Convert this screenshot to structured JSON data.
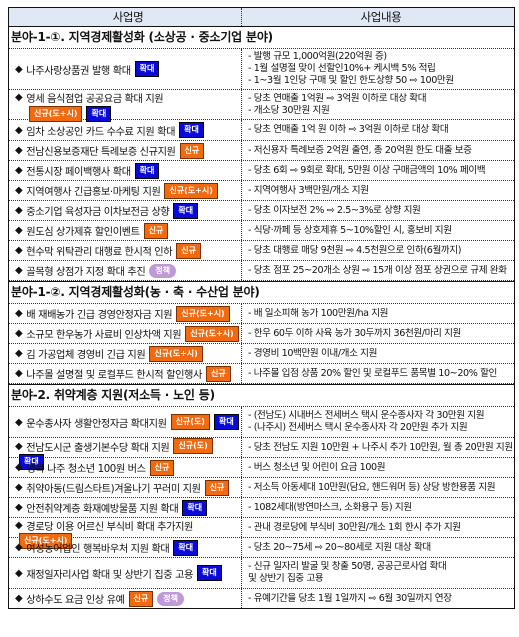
{
  "header": {
    "col1": "사업명",
    "col2": "사업내용"
  },
  "sections": [
    {
      "title": "분야-1-①. 지역경제활성화 (소상공 · 중소기업 분야)",
      "rows": [
        {
          "name": "나주사랑상품권 발행 확대",
          "badges": [
            {
              "label": "확대",
              "type": "expand"
            }
          ],
          "details": [
            "- 발행 규모 1,000억원(220억원 증)",
            "- 1월 설명절 맞이 선할인10%+ 케시백 5% 적립",
            "- 1~3월 1인당 구매 및 할인 한도상향 50 ⇨ 100만원"
          ]
        },
        {
          "name": "영세 음식점업 공공요금 확대 지원",
          "badges": [
            {
              "label": "신규(도+시)",
              "type": "new"
            },
            {
              "label": "확대",
              "type": "expand"
            }
          ],
          "wrap": true,
          "details": [
            "- 당초 연매출 1억원 ⇨ 3억원 이하로 대상 확대",
            "- 개소당 30만원 지원"
          ]
        },
        {
          "name": "임차 소상공인 카드 수수료 지원 확대",
          "badges": [
            {
              "label": "확대",
              "type": "expand"
            }
          ],
          "details": [
            "- 당초 연매출 1억 원 이하 ⇨ 3억원 이하로 대상 확대"
          ]
        },
        {
          "name": "전남신용보증재단 특례보증 신규지원",
          "badges": [
            {
              "label": "신규",
              "type": "new"
            }
          ],
          "details": [
            "- 저신용자 특례보증 2억원 출연, 총 20억원 한도 대출 보증"
          ]
        },
        {
          "name": "전통시장 페이백행사 확대",
          "badges": [
            {
              "label": "확대",
              "type": "expand"
            }
          ],
          "details": [
            "- 당초 6회 ⇨ 9회로 확대, 5만원 이상 구매금액의 10% 페이백"
          ]
        },
        {
          "name": "지역여행사 긴급홍보·마케팅 지원",
          "badges": [
            {
              "label": "신규(도+시)",
              "type": "new"
            }
          ],
          "details": [
            "- 지역여행사 3백만원/개소 지원"
          ]
        },
        {
          "name": "중소기업 육성자금 이차보전금 상향",
          "badges": [
            {
              "label": "확대",
              "type": "expand"
            }
          ],
          "details": [
            "- 당초 이자보전 2% ⇨ 2.5~3%로 상향 지원"
          ]
        },
        {
          "name": "원도심 상가제휴 할인이벤트",
          "badges": [
            {
              "label": "신규",
              "type": "new"
            }
          ],
          "details": [
            "- 식당·까페 등 상호제휴 5~10%할인 시, 홍보비 지원"
          ]
        },
        {
          "name": "현수막 위탁관리 대행료 한시적 인하",
          "badges": [
            {
              "label": "신규",
              "type": "new"
            }
          ],
          "details": [
            "- 당초 대행료 매당 9천원 ⇨ 4.5천원으로 인하(6월까지)"
          ]
        },
        {
          "name": "골목형 상점가 지정 확대 추진",
          "badges": [
            {
              "label": "정책",
              "type": "policy"
            }
          ],
          "details": [
            "- 당초 점포 25~20개소 상원 ⇨ 15개 이상 점포 상권으로 규제 완화"
          ]
        }
      ]
    },
    {
      "title": "분야-1-②. 지역경제활성화(농 · 축 · 수산업 분야)",
      "rows": [
        {
          "name": "배 재배농가 긴급 경영안정자금 지원",
          "badges": [
            {
              "label": "신규(도+시)",
              "type": "new"
            }
          ],
          "details": [
            "- 배 일소피해 농가 100만원/ha 지원"
          ]
        },
        {
          "name": "소규모 한우농가 사료비 인상차액 지원",
          "badges": [
            {
              "label": "신규(도+시)",
              "type": "new"
            }
          ],
          "details": [
            "- 한우 60두 이하 사육 농가 30두까지 36천원/마리 지원"
          ]
        },
        {
          "name": "김 가공업체 경영비 긴급 지원",
          "badges": [
            {
              "label": "신규(도+시)",
              "type": "new"
            }
          ],
          "details": [
            "- 경영비 10백만원 이내/개소 지원"
          ]
        },
        {
          "name": "나주몰 설명절 및 로컬푸드 한시적 할인행사",
          "badges": [
            {
              "label": "신규",
              "type": "new"
            }
          ],
          "details": [
            "- 나주몰 입점 상품 20% 할인 및 로컬푸드 품목별 10~20% 할인"
          ]
        }
      ]
    },
    {
      "title": "분야-2. 취약계층 지원(저소득 · 노인 등)",
      "rows": [
        {
          "name": "운수종사자 생활안정자금 확대지원",
          "badges": [
            {
              "label": "신규(도)",
              "type": "new"
            },
            {
              "label": "확대",
              "type": "expand"
            }
          ],
          "details": [
            "- (전남도) 시내버스 전세버스 택시 운수종사자 각 30만원 지원",
            "- (나주시) 전세버스 택시 운수종사자 각 20만원 추가 지원"
          ]
        },
        {
          "name": "전남도시군 출생기본수당 확대 지원",
          "badges": [
            {
              "label": "신규(도)",
              "type": "new"
            },
            {
              "label": "확대",
              "type": "expand"
            }
          ],
          "details": [
            "- 당초 전남도 지원 10만원 + 나주시 추가 10만원, 월 총 20만원 지원"
          ]
        },
        {
          "name": "행복 나주 청소년 100원 버스",
          "badges": [
            {
              "label": "신규",
              "type": "new"
            }
          ],
          "details": [
            "- 버스 청소년 및 어린이 요금 100원"
          ]
        },
        {
          "name": "취약아동(드림스타트)겨울나기 꾸러미 지원",
          "badges": [
            {
              "label": "신규",
              "type": "new"
            }
          ],
          "details": [
            "- 저소득 아동세대 10만원(담요, 핸드워머 등) 상당 방한용품 지원"
          ]
        },
        {
          "name": "안전취약계층 화재예방물품 지원 확대",
          "badges": [
            {
              "label": "확대",
              "type": "expand"
            }
          ],
          "details": [
            "- 1082세대(방연마스크, 소화용구 등) 지원"
          ]
        },
        {
          "name": "경로당 이용 어르신 부식비 확대 추가지원",
          "badges": [
            {
              "label": "신규(도+시)",
              "type": "new"
            }
          ],
          "details": [
            "- 관내 경로당에 부식비 30만원/개소 1회 한시 추가 지원"
          ]
        },
        {
          "name": "여성농어업인 행복바우처 지원 확대",
          "badges": [
            {
              "label": "확대",
              "type": "expand"
            }
          ],
          "details": [
            "- 당초 20~75세 ⇨ 20~80세로 지원 대상 확대"
          ]
        },
        {
          "name": "재정일자리사업 확대 및 상반기 집중 고용",
          "badges": [
            {
              "label": "확대",
              "type": "expand"
            }
          ],
          "details": [
            "- 신규 일자리 발굴 및 창출 50명, 공공근로사업 확대",
            "  및 상반기 집중 고용"
          ]
        },
        {
          "name": "상하수도 요금 인상 유예",
          "badges": [
            {
              "label": "신규",
              "type": "new"
            },
            {
              "label": "정책",
              "type": "policy"
            }
          ],
          "details": [
            "- 유예기간을 당초 1월 1일까지 ⇨ 6월 30일까지 연장"
          ]
        }
      ]
    }
  ],
  "colors": {
    "header_bg": "#dfe8f4",
    "badge_expand": "#0a0ad8",
    "badge_new": "#f26a10",
    "badge_policy": "#c09ad8"
  }
}
